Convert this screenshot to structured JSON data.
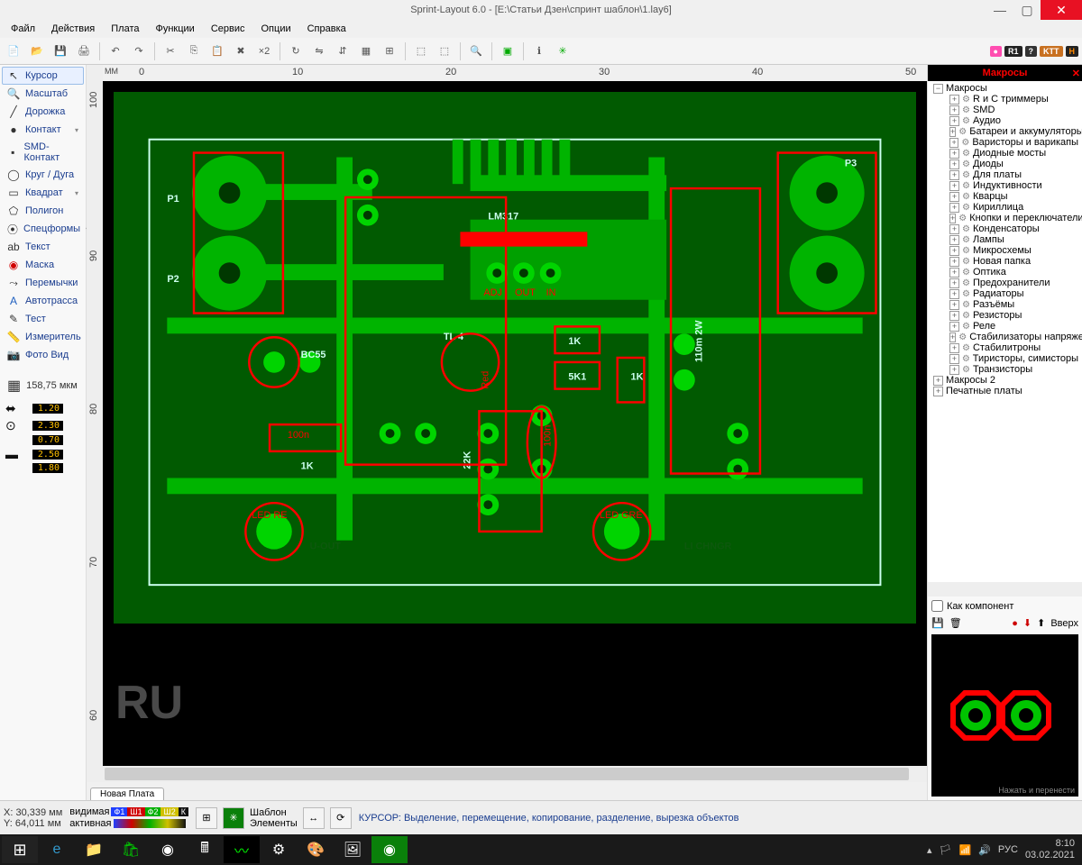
{
  "title": "Sprint-Layout 6.0 - [E:\\Статьи Дзен\\спринт шаблон\\1.lay6]",
  "menu": [
    "Файл",
    "Действия",
    "Плата",
    "Функции",
    "Сервис",
    "Опции",
    "Справка"
  ],
  "left_tools": [
    {
      "icon": "↖",
      "label": "Курсор",
      "active": true
    },
    {
      "icon": "🔍",
      "label": "Масштаб"
    },
    {
      "icon": "╱",
      "label": "Дорожка"
    },
    {
      "icon": "●",
      "label": "Контакт",
      "arrow": true
    },
    {
      "icon": "▪",
      "label": "SMD-Контакт"
    },
    {
      "icon": "◯",
      "label": "Круг / Дуга"
    },
    {
      "icon": "▭",
      "label": "Квадрат",
      "arrow": true
    },
    {
      "icon": "⬠",
      "label": "Полигон"
    },
    {
      "icon": "⦿",
      "label": "Спецформы",
      "arrow": true
    },
    {
      "icon": "ab",
      "label": "Текст"
    },
    {
      "icon": "◉",
      "label": "Маска",
      "color": "#d00000"
    },
    {
      "icon": "⤳",
      "label": "Перемычки"
    },
    {
      "icon": "A",
      "label": "Автотрасса",
      "color": "#2060c0"
    },
    {
      "icon": "✎",
      "label": "Тест"
    },
    {
      "icon": "📏",
      "label": "Измеритель"
    },
    {
      "icon": "📷",
      "label": "Фото Вид"
    }
  ],
  "grid_value": "158,75 мкм",
  "track_values": {
    "w1": "1.20",
    "w2a": "2.30",
    "w2b": "0.70",
    "w3a": "2.50",
    "w3b": "1.80"
  },
  "ruler": {
    "unit": "ММ",
    "h_ticks": [
      "0",
      "10",
      "20",
      "30",
      "40",
      "50"
    ],
    "v_ticks": [
      "100",
      "90",
      "80",
      "70",
      "60"
    ]
  },
  "pcb_labels": {
    "p1": "P1",
    "p2": "P2",
    "p3": "P3",
    "lm317": "LM317",
    "adj": "ADJ",
    "out": "OUT",
    "in": "IN",
    "bc55": "BC55",
    "r1k": "1K",
    "r5k1": "5K1",
    "r1k_b": "1K",
    "r1k_c": "1K",
    "r22k": "22K",
    "c100n": "100n",
    "c100n_b": "100n",
    "r110m": "110m 2W",
    "uout": "U-OUT",
    "chngr": "LI CHNGR",
    "ledred": "LED RE",
    "ledgrn": "LED GRE",
    "tl": "TL 4",
    "red": "Red"
  },
  "ru_mark": "RU",
  "tab": "Новая Плата",
  "right_panel": {
    "title": "Макросы",
    "root": "Макросы",
    "items": [
      "R и C триммеры",
      "SMD",
      "Аудио",
      "Батареи и аккумуляторы",
      "Варисторы и варикапы",
      "Диодные мосты",
      "Диоды",
      "Для платы",
      "Индуктивности",
      "Кварцы",
      "Кириллица",
      "Кнопки и переключатели",
      "Конденсаторы",
      "Лампы",
      "Микросхемы",
      "Новая папка",
      "Оптика",
      "Предохранители",
      "Радиаторы",
      "Разъёмы",
      "Резисторы",
      "Реле",
      "Стабилизаторы напряжения",
      "Стабилитроны",
      "Тиристоры, симисторы",
      "Транзисторы"
    ],
    "extra": [
      "Макросы 2",
      "Печатные платы"
    ],
    "checkbox": "Как компонент",
    "up_label": "Вверх",
    "hint": "Нажать и перенести"
  },
  "status": {
    "x": "X:  30,339 мм",
    "y": "Y:  64,011 мм",
    "vis": "видимая",
    "act": "активная",
    "layers": [
      {
        "t": "Ф1",
        "c": "#2040ff"
      },
      {
        "t": "Ш1",
        "c": "#d00000"
      },
      {
        "t": "Ф2",
        "c": "#00b000"
      },
      {
        "t": "Ш2",
        "c": "#d0c000"
      },
      {
        "t": "К",
        "c": "#111"
      }
    ],
    "template": "Шаблон",
    "elements": "Элементы",
    "cursor_info": "КУРСОР: Выделение, перемещение, копирование, разделение, вырезка объектов"
  },
  "taskbar": {
    "lang": "РУС",
    "time": "8:10",
    "date": "03.02.2021"
  },
  "badges": [
    "●",
    "R1",
    "?",
    "KTT",
    "H"
  ]
}
